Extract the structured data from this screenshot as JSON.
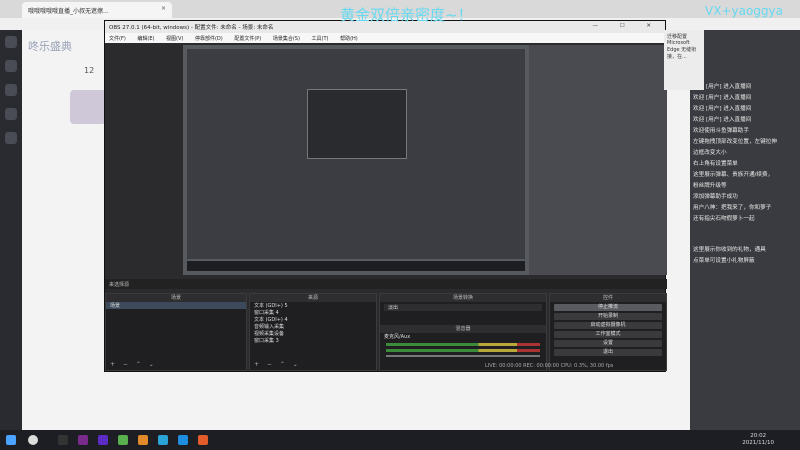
{
  "browser": {
    "tab_title": "哦哦哦哦哦直播_小叔无遮擦...",
    "tab_close": "×"
  },
  "page": {
    "logo": "咚乐盛典",
    "viewer_count": "12"
  },
  "overlay": {
    "banner": "黄金双倍亲密度~！",
    "vx": "VX+yaoggya"
  },
  "obs": {
    "title": "OBS 27.0.1 (64-bit, windows) - 配置文件: 未命名 - 场景: 未命名",
    "menu": [
      "文件(F)",
      "编辑(E)",
      "视图(V)",
      "停靠部件(D)",
      "配置文件(P)",
      "场景集合(S)",
      "工具(T)",
      "帮助(H)"
    ],
    "window_buttons": "— ☐ ✕",
    "scene_label": "来选择源",
    "docks": {
      "scenes_header": "场景",
      "sources_header": "来源",
      "filters_header": "场景转换",
      "controls_header": "控件"
    },
    "scenes": [
      "场景"
    ],
    "sources": [
      "文本 (GDI+) 5",
      "窗口采集 4",
      "文本 (GDI+) 4",
      "音频输入采集",
      "视频采集设备",
      "窗口采集 3"
    ],
    "filters": {
      "selected": "淡出",
      "mixer_label": "混音器",
      "mixer_item": "麦克风/Aux"
    },
    "controls": [
      "停止推流",
      "开始录制",
      "启动虚拟摄像机",
      "工作室模式",
      "设置",
      "退出"
    ],
    "footer_icons": "+ − ⌃ ⌄",
    "status": "LIVE: 00:00:00   REC: 00:00:00   CPU: 0.3%, 30.00 fps"
  },
  "edge_popup": {
    "title": "迁移配置",
    "text": "Microsoft Edge 无缝衔接，在..."
  },
  "chat": {
    "messages": [
      "欢迎 [用户] 进入直播间",
      "欢迎 [用户] 进入直播间",
      "欢迎 [用户] 进入直播间",
      "欢迎 [用户] 进入直播间",
      "欢迎使用斗鱼弹幕助手",
      "左键拖拽顶部改变位置，左键拉伸",
      "边框改变大小",
      "右上角有设置菜单",
      "这里展示弹幕、贵族开通/续费，",
      "粉丝牌升级等",
      "添加弹幕助手成功",
      "用户八神：把我来了，你和萝子",
      "还有指尖石吻假萝卜一起",
      "这里展示你收到的礼物，通具",
      "点菜单可设置小礼物屏蔽"
    ]
  },
  "taskbar": {
    "time": "20:02",
    "date": "2021/11/10"
  }
}
